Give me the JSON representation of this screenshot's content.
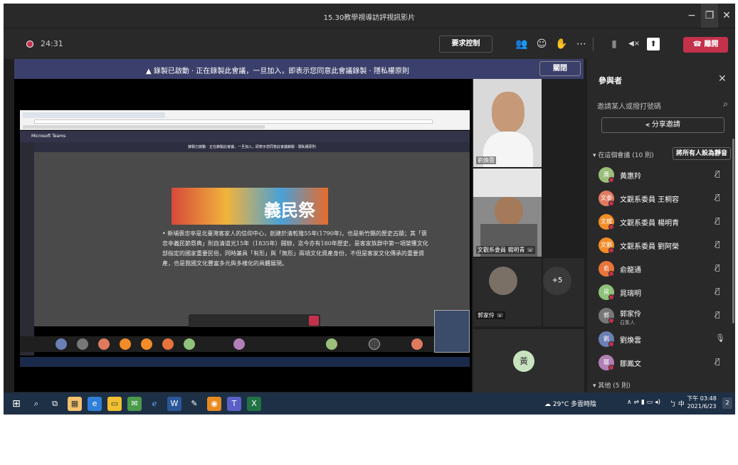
{
  "window": {
    "title": "15.30教學視導訪評視訊影片",
    "minimize": "−",
    "restore": "❐",
    "close": "✕"
  },
  "toolbar": {
    "timer": "24:31",
    "request_control": "要求控制",
    "participants_icon": "👥",
    "chat_icon": "☺",
    "reactions_icon": "✋",
    "more_icon": "⋯",
    "camera_icon": "▮",
    "mic_icon": "◀×",
    "share_icon": "⬆",
    "leave": "離開"
  },
  "banner": {
    "text": "▲ 錄製已啟動 · 正在錄製此會議，一旦加入，即表示您同意此會議錄製 · 隱私權原則",
    "close": "關閉"
  },
  "stage": {
    "teams_title": "Microsoft Teams",
    "shared_banner": "錄製已啟動 · 正在錄製此會議，一旦加入，即表示您同意此會議錄製 · 隱私權原則",
    "slide_logo": "義民祭",
    "slide_text": "• 新埔褒忠亭是北臺灣客家人的信仰中心，創建於清乾隆55年(1790年)，也是新竹縣的歷史古蹟；其「褒忠亭義民節祭典」則自清道光15年（1835年）開辦，迄今亦有180年歷史，是客家族群中第一項榮獲文化部指定的國家重要民俗，同時兼具「有形」與「無形」兩項文化資產身份，不但是客家文化傳承的重要資產，也是我國文化豐富多元與多樣化的具體展現。",
    "caption": "郭家伶 ☏"
  },
  "video": {
    "tile1_name": "劉煥雲",
    "tile2_name": "文觀系委員 楊明青 ☏",
    "tile3_name": "郭家伶 ☏",
    "plus_count": "+5",
    "avatar_letter": "黃"
  },
  "panel": {
    "title": "參與者",
    "close": "✕",
    "search_placeholder": "邀請某人或撥打號碼",
    "search_icon": "⌕",
    "share_invite": "⪪ 分享邀請",
    "in_meeting": "▾ 在這個會議 (10 則)",
    "mute_all": "將所有人設為靜音",
    "participants": [
      {
        "initial": "黃",
        "name": "黃惠羚",
        "sub": "",
        "color": "#9bbf7a",
        "status": "#c4314b",
        "mic": "🎙̸"
      },
      {
        "initial": "文委",
        "name": "文觀系委員 王桐容",
        "sub": "",
        "color": "#e07a5f",
        "status": "#c4314b",
        "mic": "🎙̸"
      },
      {
        "initial": "文楊",
        "name": "文觀系委員 楊明青",
        "sub": "",
        "color": "#f28c28",
        "status": "#c4314b",
        "mic": "🎙̸"
      },
      {
        "initial": "文劉",
        "name": "文觀系委員 劉阿榮",
        "sub": "",
        "color": "#f28c28",
        "status": "#c4314b",
        "mic": "🎙̸"
      },
      {
        "initial": "俞",
        "name": "俞龍通",
        "sub": "",
        "color": "#e8743b",
        "status": "#c4314b",
        "mic": "🎙̸"
      },
      {
        "initial": "晁",
        "name": "晁瑞明",
        "sub": "",
        "color": "#8fc27a",
        "status": "#c4314b",
        "mic": "🎙̸"
      },
      {
        "initial": "郭",
        "name": "郭家伶",
        "sub": "召集人",
        "color": "#777777",
        "status": "#c4314b",
        "mic": "🎙̸"
      },
      {
        "initial": "劉",
        "name": "劉煥雲",
        "sub": "",
        "color": "#6b7fb5",
        "status": "#c4314b",
        "mic": "🎙"
      },
      {
        "initial": "鄒",
        "name": "鄒鳳文",
        "sub": "",
        "color": "#b07fb5",
        "status": "#c4314b",
        "mic": "🎙̸"
      }
    ],
    "others": "▾ 其他 (5 則)"
  },
  "taskbar": {
    "weather": "☁ 29°C 多雲時陰",
    "ime": "ㄅ 中",
    "time": "下午 03:48",
    "date": "2021/6/23",
    "notif": "2"
  }
}
